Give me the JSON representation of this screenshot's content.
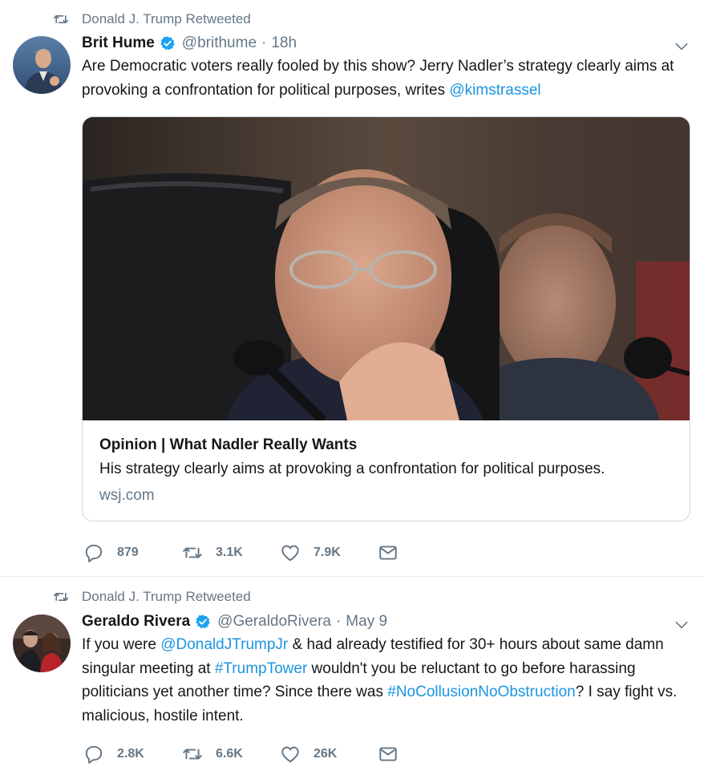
{
  "tweets": [
    {
      "retweet_by": "Donald J. Trump Retweeted",
      "author_name": "Brit Hume",
      "handle": "@brithume",
      "separator": "·",
      "time": "18h",
      "text_parts": [
        {
          "text": "Are Democratic voters really fooled by this show? Jerry Nadler’s strategy clearly aims at provoking a confrontation for political purposes, writes ",
          "link": false
        },
        {
          "text": "@kimstrassel",
          "link": true
        }
      ],
      "card": {
        "title": "Opinion | What Nadler Really Wants",
        "description": "His strategy clearly aims at provoking a confrontation for political purposes.",
        "domain": "wsj.com"
      },
      "actions": {
        "replies": "879",
        "retweets": "3.1K",
        "likes": "7.9K"
      }
    },
    {
      "retweet_by": "Donald J. Trump Retweeted",
      "author_name": "Geraldo Rivera",
      "handle": "@GeraldoRivera",
      "separator": "·",
      "time": "May 9",
      "text_parts": [
        {
          "text": "If you were ",
          "link": false
        },
        {
          "text": "@DonaldJTrumpJr",
          "link": true
        },
        {
          "text": " & had already testified for 30+ hours about same damn singular meeting at ",
          "link": false
        },
        {
          "text": "#TrumpTower",
          "link": true
        },
        {
          "text": " wouldn't you be reluctant to go before harassing politicians yet another time? Since there was ",
          "link": false
        },
        {
          "text": "#NoCollusionNoObstruction",
          "link": true
        },
        {
          "text": "? I say fight vs. malicious, hostile intent.",
          "link": false
        }
      ],
      "actions": {
        "replies": "2.8K",
        "retweets": "6.6K",
        "likes": "26K"
      }
    }
  ],
  "icons": {
    "retweet": "retweet-icon",
    "verified": "verified-badge-icon",
    "chevron": "chevron-down-icon",
    "reply": "reply-icon",
    "like": "heart-icon",
    "dm": "envelope-icon"
  },
  "colors": {
    "link": "#1b95e0",
    "secondary_text": "#657786",
    "verified": "#1da1f2",
    "border": "#ccd6dd"
  }
}
